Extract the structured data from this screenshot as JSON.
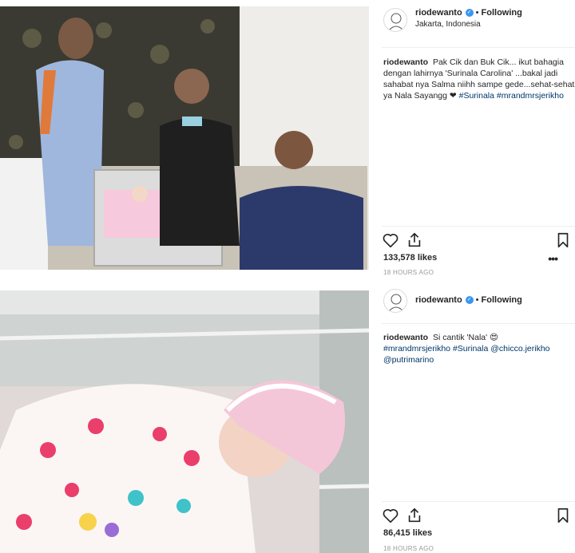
{
  "posts": [
    {
      "username": "riodewanto",
      "follow_label": "Following",
      "location": "Jakarta, Indonesia",
      "caption_user": "riodewanto",
      "caption_text": "Pak Cik dan Buk Cik... ikut bahagia dengan lahirnya 'Surinala Carolina' ...bakal jadi sahabat nya Salma niihh sampe gede...sehat-sehat ya Nala Sayangg ❤",
      "hashtags": [
        "#Surinala",
        "#mrandmrsjerikho"
      ],
      "likes": "133,578 likes",
      "time": "18 HOURS AGO"
    },
    {
      "username": "riodewanto",
      "follow_label": "Following",
      "caption_user": "riodewanto",
      "caption_text": "Si cantik 'Nala' 😍",
      "hashtags": [
        "#mrandmrsjerikho",
        "#Surinala"
      ],
      "mentions": [
        "@chicco.jerikho",
        "@putrimarino"
      ],
      "likes": "86,415 likes",
      "time": "18 HOURS AGO"
    }
  ],
  "icons": [
    "heart-icon",
    "share-icon",
    "bookmark-icon",
    "more-options-icon",
    "verified-badge-icon"
  ],
  "colors": {
    "verified": "#3897f0",
    "hashtag": "#003569",
    "timestamp": "#999999"
  }
}
